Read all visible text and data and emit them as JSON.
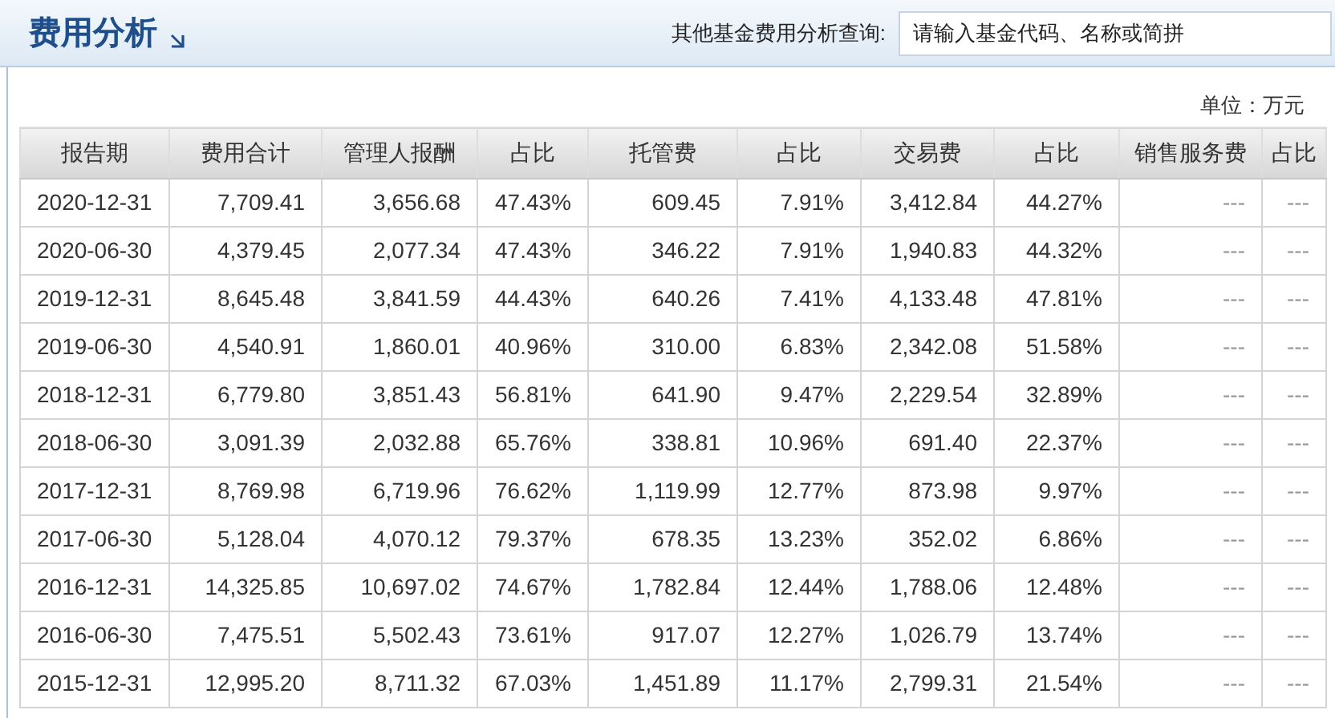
{
  "header": {
    "title": "费用分析",
    "query_label": "其他基金费用分析查询:",
    "search": {
      "placeholder": "请输入基金代码、名称或简拼"
    }
  },
  "unit": "单位：万元",
  "table": {
    "columns": [
      "报告期",
      "费用合计",
      "管理人报酬",
      "占比",
      "托管费",
      "占比",
      "交易费",
      "占比",
      "销售服务费",
      "占比"
    ],
    "rows": [
      [
        "2020-12-31",
        "7,709.41",
        "3,656.68",
        "47.43%",
        "609.45",
        "7.91%",
        "3,412.84",
        "44.27%",
        "---",
        "---"
      ],
      [
        "2020-06-30",
        "4,379.45",
        "2,077.34",
        "47.43%",
        "346.22",
        "7.91%",
        "1,940.83",
        "44.32%",
        "---",
        "---"
      ],
      [
        "2019-12-31",
        "8,645.48",
        "3,841.59",
        "44.43%",
        "640.26",
        "7.41%",
        "4,133.48",
        "47.81%",
        "---",
        "---"
      ],
      [
        "2019-06-30",
        "4,540.91",
        "1,860.01",
        "40.96%",
        "310.00",
        "6.83%",
        "2,342.08",
        "51.58%",
        "---",
        "---"
      ],
      [
        "2018-12-31",
        "6,779.80",
        "3,851.43",
        "56.81%",
        "641.90",
        "9.47%",
        "2,229.54",
        "32.89%",
        "---",
        "---"
      ],
      [
        "2018-06-30",
        "3,091.39",
        "2,032.88",
        "65.76%",
        "338.81",
        "10.96%",
        "691.40",
        "22.37%",
        "---",
        "---"
      ],
      [
        "2017-12-31",
        "8,769.98",
        "6,719.96",
        "76.62%",
        "1,119.99",
        "12.77%",
        "873.98",
        "9.97%",
        "---",
        "---"
      ],
      [
        "2017-06-30",
        "5,128.04",
        "4,070.12",
        "79.37%",
        "678.35",
        "13.23%",
        "352.02",
        "6.86%",
        "---",
        "---"
      ],
      [
        "2016-12-31",
        "14,325.85",
        "10,697.02",
        "74.67%",
        "1,782.84",
        "12.44%",
        "1,788.06",
        "12.48%",
        "---",
        "---"
      ],
      [
        "2016-06-30",
        "7,475.51",
        "5,502.43",
        "73.61%",
        "917.07",
        "12.27%",
        "1,026.79",
        "13.74%",
        "---",
        "---"
      ],
      [
        "2015-12-31",
        "12,995.20",
        "8,711.32",
        "67.03%",
        "1,451.89",
        "11.17%",
        "2,799.31",
        "21.54%",
        "---",
        "---"
      ]
    ]
  }
}
